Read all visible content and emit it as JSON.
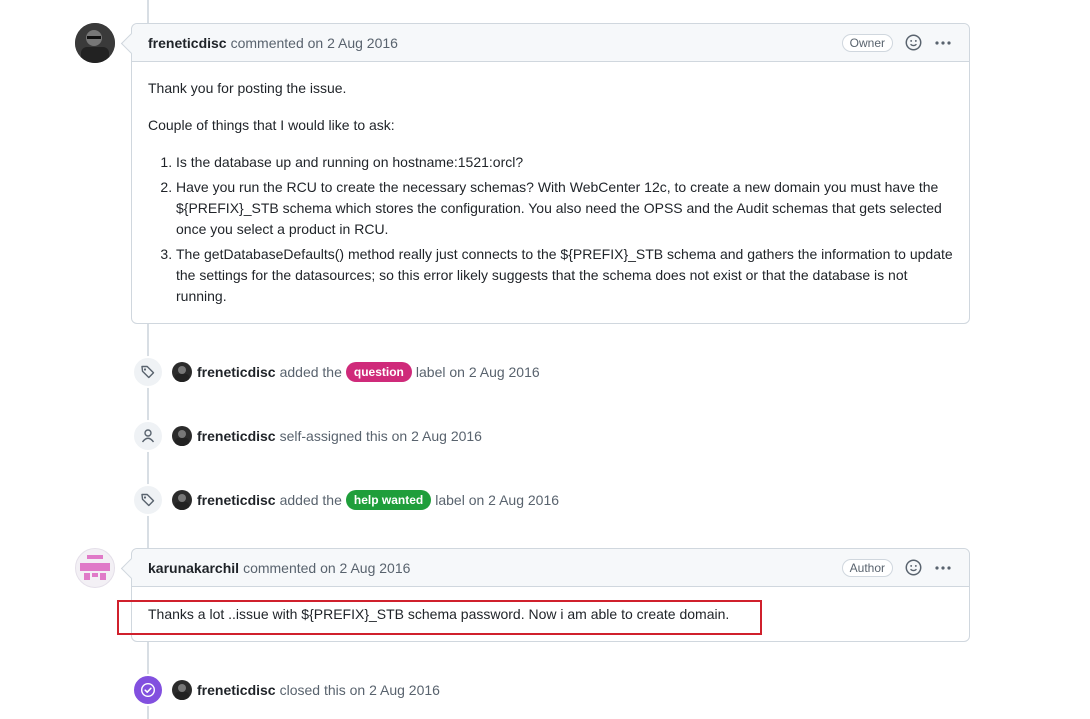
{
  "comments": [
    {
      "author": "freneticdisc",
      "meta": "commented on 2 Aug 2016",
      "role": "Owner",
      "body": {
        "intro": "Thank you for posting the issue.",
        "lead": "Couple of things that I would like to ask:",
        "items": [
          "Is the database up and running on hostname:1521:orcl?",
          "Have you run the RCU to create the necessary schemas? With WebCenter 12c, to create a new domain you must have the ${PREFIX}_STB schema which stores the configuration. You also need the OPSS and the Audit schemas that gets selected once you select a product in RCU.",
          "The getDatabaseDefaults() method really just connects to the ${PREFIX}_STB schema and gathers the information to update the settings for the datasources; so this error likely suggests that the schema does not exist or that the database is not running."
        ]
      }
    },
    {
      "author": "karunakarchil",
      "meta": "commented on 2 Aug 2016",
      "role": "Author",
      "body": {
        "text": "Thanks a lot ..issue with ${PREFIX}_STB schema password. Now i am able to create domain."
      }
    }
  ],
  "events": [
    {
      "icon": "tag-icon",
      "author": "freneticdisc",
      "pre": "added the",
      "label": "question",
      "label_color": "#cf2a7a",
      "post": "label on 2 Aug 2016"
    },
    {
      "icon": "person-icon",
      "author": "freneticdisc",
      "pre": "self-assigned this on 2 Aug 2016"
    },
    {
      "icon": "tag-icon",
      "author": "freneticdisc",
      "pre": "added the",
      "label": "help wanted",
      "label_color": "#1f9e3b",
      "post": "label on 2 Aug 2016"
    },
    {
      "icon": "closed-check-icon",
      "author": "freneticdisc",
      "pre": "closed this on 2 Aug 2016"
    }
  ]
}
